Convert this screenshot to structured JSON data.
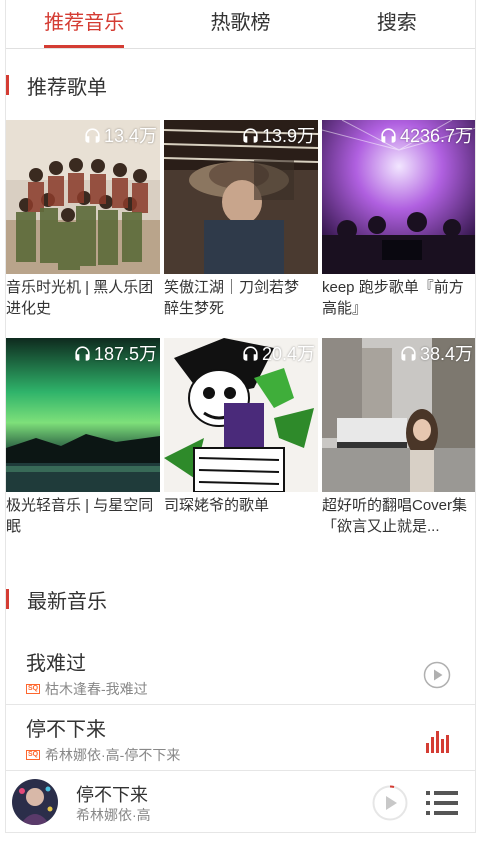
{
  "tabs": [
    {
      "label": "推荐音乐"
    },
    {
      "label": "热歌榜"
    },
    {
      "label": "搜索"
    }
  ],
  "sections": {
    "recommended": "推荐歌单",
    "newest": "最新音乐"
  },
  "playlists": [
    {
      "count": "13.4万",
      "name": "音乐时光机 | 黑人乐团进化史"
    },
    {
      "count": "13.9万",
      "name": "笑傲江湖｜刀剑若梦 醉生梦死"
    },
    {
      "count": "4236.7万",
      "name": "keep 跑步歌单『前方高能』"
    },
    {
      "count": "187.5万",
      "name": "极光轻音乐 | 与星空同眠"
    },
    {
      "count": "20.4万",
      "name": "司琛姥爷的歌单"
    },
    {
      "count": "38.4万",
      "name": "超好听的翻唱Cover集「欲言又止就是..."
    }
  ],
  "songs": [
    {
      "title": "我难过",
      "artist": "枯木逢春-我难过",
      "badge": "SQ",
      "action_icon": "play-circle-icon"
    },
    {
      "title": "停不下来",
      "artist": "希林娜依·高-停不下来",
      "badge": "SQ",
      "action_icon": "equalizer-icon"
    }
  ],
  "player": {
    "title": "停不下来",
    "artist": "希林娜依·高"
  },
  "colors": {
    "accent": "#d43c33",
    "sq_badge": "#fe672e"
  }
}
